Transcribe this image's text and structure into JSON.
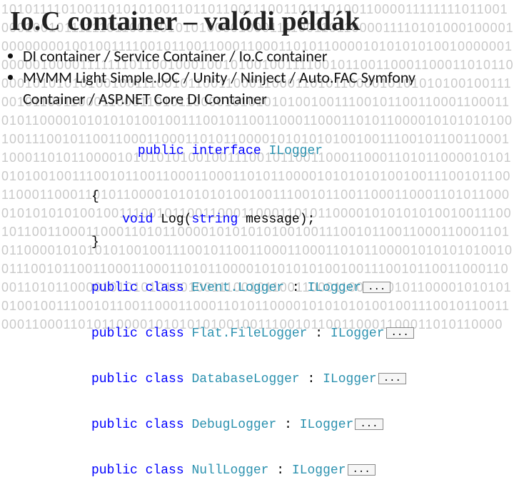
{
  "title": "Io.C container – valódi példák",
  "bullets": [
    "DI container / Service Container / Io.C container",
    "MVMM Light Simple.IOC / Unity / Ninject / Auto.FAC Symfony Container / ASP.NET Core DI Container"
  ],
  "code": {
    "kw_public": "public",
    "kw_interface": "interface",
    "kw_class": "class",
    "kw_void": "void",
    "iface": "ILogger",
    "method": "Log",
    "param_type": "string",
    "param_name": "message",
    "brace_open": "{",
    "brace_close": "}",
    "paren_open": "(",
    "paren_close": ")",
    "semi": ";",
    "colon": " : ",
    "ellipsis": "...",
    "classes": [
      "Event.Logger",
      "Flat.FileLogger",
      "DatabaseLogger",
      "DebugLogger",
      "NullLogger"
    ]
  },
  "bg_binary": "10101111010011010101001101101100111001101110100110000111111110110010001001011111101100110101010000100011110011011000011110101000100001000000001001001111001011001100011000110101100001010101010010000001000001000011111110110010001001010010011110010110011000110001101011000010101010100100111001011001100011000110101100001010101010010011100101100110001100011010110000101010101001001110010110011000110001101011000010101010100100111001011001100011000110101100001010101010010011100101100110001100011010110000101010101001001110010110011000110001101011000010101010100100111001011001100011000110101100001010101010010011100101100110001100011010110000101010101001001110010110011000110001101011000010101010100100111001011001100011000110101100001010101010010011100101100110001100011010110000101010101001001110010110011000110001101011000010101010100100111001011001100011000110101100001010101010010011100101100110001100011010110000101010101001001110010110011000110001101011000010101010100100111001011001100011000110101100001010101010010011100101100110001100011010110000101010101001001110010110011000110001101011000010101010100100111001011001100011000110101100001010101010010011100101100110001100011010110000"
}
